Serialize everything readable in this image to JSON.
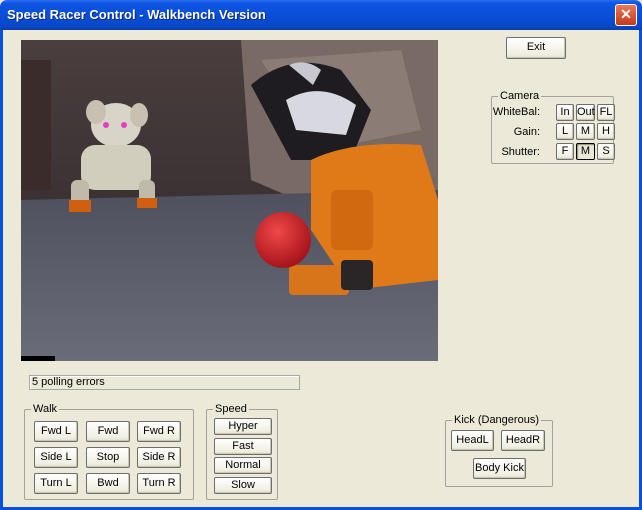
{
  "window": {
    "title": "Speed Racer Control - Walkbench Version",
    "close_glyph": "✕"
  },
  "exit_label": "Exit",
  "status_text": "5 polling errors",
  "camera": {
    "legend": "Camera",
    "whitebal_label": "WhiteBal:",
    "gain_label": "Gain:",
    "shutter_label": "Shutter:",
    "whitebal_buttons": [
      "In",
      "Out",
      "FL"
    ],
    "gain_buttons": [
      "L",
      "M",
      "H"
    ],
    "shutter_buttons": [
      "F",
      "M",
      "S"
    ],
    "shutter_selected": "M"
  },
  "walk": {
    "legend": "Walk",
    "buttons": [
      "Fwd L",
      "Fwd",
      "Fwd R",
      "Side L",
      "Stop",
      "Side R",
      "Turn L",
      "Bwd",
      "Turn R"
    ]
  },
  "speed": {
    "legend": "Speed",
    "buttons": [
      "Hyper",
      "Fast",
      "Normal",
      "Slow"
    ]
  },
  "kick": {
    "legend": "Kick (Dangerous)",
    "headl": "HeadL",
    "headr": "HeadR",
    "body": "Body Kick"
  },
  "colors": {
    "titlebar": "#0a4fd9",
    "dialog_bg": "#ece9d8",
    "ball": "#d8202a",
    "robot_orange": "#e07a18"
  },
  "camera_scene": {
    "objects": [
      "carpet",
      "couch",
      "white-robot-dog",
      "orange-robot-dog",
      "red-ball"
    ]
  }
}
